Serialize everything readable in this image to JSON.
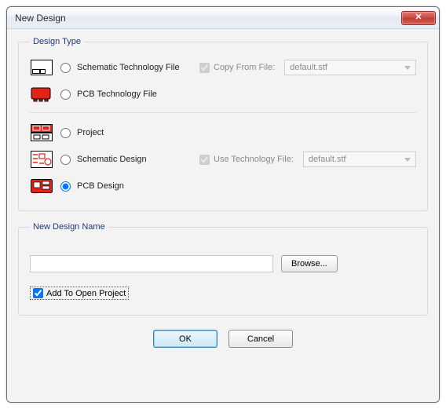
{
  "window": {
    "title": "New Design"
  },
  "groups": {
    "design_type": {
      "legend": "Design Type"
    },
    "new_name": {
      "legend": "New Design Name"
    }
  },
  "options": {
    "schematic_tech": {
      "label": "Schematic Technology File"
    },
    "pcb_tech": {
      "label": "PCB Technology File"
    },
    "project": {
      "label": "Project"
    },
    "schematic": {
      "label": "Schematic Design"
    },
    "pcb": {
      "label": "PCB Design"
    }
  },
  "copy_from": {
    "label": "Copy From File:",
    "value": "default.stf"
  },
  "use_tech": {
    "label": "Use Technology File:",
    "value": "default.stf"
  },
  "new_name": {
    "value": "",
    "browse": "Browse..."
  },
  "add_open": {
    "label": "Add To Open Project"
  },
  "buttons": {
    "ok": "OK",
    "cancel": "Cancel"
  }
}
